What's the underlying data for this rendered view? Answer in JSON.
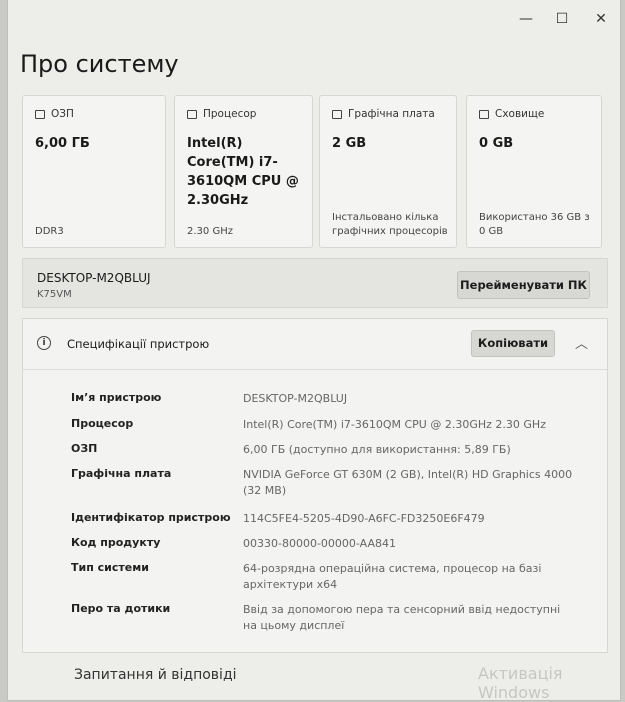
{
  "window": {
    "minimize_glyph": "—",
    "maximize_glyph": "☐",
    "close_glyph": "✕"
  },
  "page_title": "Про систему",
  "cards": [
    {
      "label": "ОЗП",
      "value": "6,00 ГБ",
      "footer": "DDR3",
      "icon": "ram-icon"
    },
    {
      "label": "Процесор",
      "value": "Intel(R) Core(TM) i7-3610QM CPU @ 2.30GHz",
      "footer": "2.30 GHz",
      "icon": "cpu-icon"
    },
    {
      "label": "Графічна плата",
      "value": "2 GB",
      "footer": "Інстальовано кілька графічних процесорів",
      "icon": "gpu-icon"
    },
    {
      "label": "Сховище",
      "value": "0 GB",
      "footer": "Використано 36 GB з 0 GB",
      "icon": "storage-icon"
    }
  ],
  "device": {
    "name": "DESKTOP-M2QBLUJ",
    "model": "K75VM",
    "rename_label": "Перейменувати ПК"
  },
  "specs": {
    "title": "Специфікації пристрою",
    "copy_label": "Копіювати",
    "rows": [
      {
        "label": "Ім’я пристрою",
        "value": "DESKTOP-M2QBLUJ"
      },
      {
        "label": "Процесор",
        "value": "Intel(R) Core(TM) i7-3610QM CPU @ 2.30GHz   2.30 GHz"
      },
      {
        "label": "ОЗП",
        "value": "6,00 ГБ (доступно для використання: 5,89 ГБ)"
      },
      {
        "label": "Графічна плата",
        "value": "NVIDIA GeForce GT 630M (2 GB), Intel(R) HD Graphics 4000 (32 MB)"
      },
      {
        "label": "Ідентифікатор пристрою",
        "value": "114C5FE4-5205-4D90-A6FC-FD3250E6F479"
      },
      {
        "label": "Код продукту",
        "value": "00330-80000-00000-AA841"
      },
      {
        "label": "Тип системи",
        "value": "64-розрядна операційна система, процесор на базі архітектури x64"
      },
      {
        "label": "Перо та дотики",
        "value": "Ввід за допомогою пера та сенсорний ввід недоступні на цьому дисплеї"
      }
    ]
  },
  "faq_title": "Запитання й відповіді",
  "watermark": "Активація Windows"
}
